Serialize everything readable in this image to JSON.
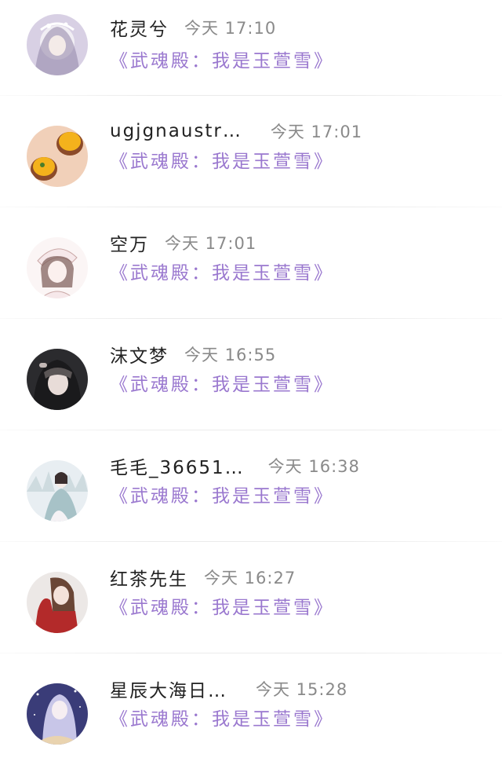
{
  "comments": [
    {
      "name": "花灵兮",
      "time": "今天 17:10",
      "text": "《武魂殿：我是玉萱雪》",
      "avatar": "avatar-anime-girl-silver-hair-icon",
      "colors": [
        "#d8d0e4",
        "#8f84a6",
        "#f1eef4"
      ]
    },
    {
      "name": "ugjgnaustr…",
      "time": "今天 17:01",
      "text": "《武魂殿：我是玉萱雪》",
      "avatar": "avatar-egg-tarts-icon",
      "colors": [
        "#f1d0b9",
        "#f4b21c",
        "#8c4b2a"
      ]
    },
    {
      "name": "空万",
      "time": "今天 17:01",
      "text": "《武魂殿：我是玉萱雪》",
      "avatar": "avatar-sketch-girl-hat-icon",
      "colors": [
        "#f6e8ea",
        "#7a5a55",
        "#fbf5f5"
      ]
    },
    {
      "name": "沫文梦",
      "time": "今天 16:55",
      "text": "《武魂殿：我是玉萱雪》",
      "avatar": "avatar-dark-hair-girl-icon",
      "colors": [
        "#2b2b2e",
        "#5b5656",
        "#e8dcd8"
      ]
    },
    {
      "name": "毛毛_36651…",
      "time": "今天 16:38",
      "text": "《武魂殿：我是玉萱雪》",
      "avatar": "avatar-snow-girl-icon",
      "colors": [
        "#e8eef2",
        "#a7c2c7",
        "#f5f2f5"
      ]
    },
    {
      "name": "红茶先生",
      "time": "今天 16:27",
      "text": "《武魂殿：我是玉萱雪》",
      "avatar": "avatar-red-dress-girl-icon",
      "colors": [
        "#ece8e6",
        "#b32a2a",
        "#6a4636"
      ]
    },
    {
      "name": "星辰大海日…",
      "time": "今天 15:28",
      "text": "《武魂殿：我是玉萱雪》",
      "avatar": "avatar-starry-night-girl-icon",
      "colors": [
        "#3a3c78",
        "#c8c6e8",
        "#f1d6a0"
      ]
    }
  ]
}
